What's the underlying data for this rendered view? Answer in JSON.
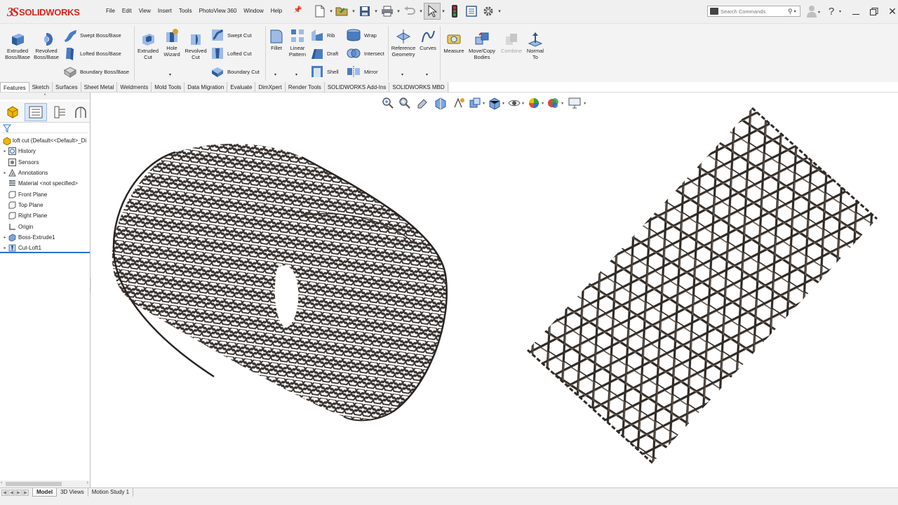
{
  "app": {
    "logo_mark": "3S",
    "logo_text": "SOLIDWORKS"
  },
  "menu": [
    "File",
    "Edit",
    "View",
    "Insert",
    "Tools",
    "PhotoView 360",
    "Window",
    "Help"
  ],
  "search": {
    "placeholder": "Search Commands"
  },
  "toolbar": {
    "extruded_boss": "Extruded Boss/Base",
    "revolved_boss": "Revolved Boss/Base",
    "swept_boss": "Swept Boss/Base",
    "lofted_boss": "Lofted Boss/Base",
    "boundary_boss": "Boundary Boss/Base",
    "extruded_cut": "Extruded Cut",
    "hole_wizard": "Hole Wizard",
    "revolved_cut": "Revolved Cut",
    "swept_cut": "Swept Cut",
    "lofted_cut": "Lofted Cut",
    "boundary_cut": "Boundary Cut",
    "fillet": "Fillet",
    "linear_pattern": "Linear Pattern",
    "rib": "Rib",
    "draft": "Draft",
    "shell": "Shell",
    "wrap": "Wrap",
    "intersect": "Intersect",
    "mirror": "Mirror",
    "reference_geometry": "Reference Geometry",
    "curves": "Curves",
    "measure": "Measure",
    "move_copy": "Move/Copy Bodies",
    "combine": "Combine",
    "normal_to": "Normal To"
  },
  "tabs": [
    "Features",
    "Sketch",
    "Surfaces",
    "Sheet Metal",
    "Weldments",
    "Mold Tools",
    "Data Migration",
    "Evaluate",
    "DimXpert",
    "Render Tools",
    "SOLIDWORKS Add-Ins",
    "SOLIDWORKS MBD"
  ],
  "active_tab": "Features",
  "tree": {
    "root": "loft cut  (Default<<Default>_Di",
    "items": [
      {
        "label": "History",
        "icon": "history-icon",
        "expandable": true
      },
      {
        "label": "Sensors",
        "icon": "sensors-icon",
        "expandable": false
      },
      {
        "label": "Annotations",
        "icon": "annotations-icon",
        "expandable": true
      },
      {
        "label": "Material <not specified>",
        "icon": "material-icon",
        "expandable": false
      },
      {
        "label": "Front Plane",
        "icon": "plane-icon",
        "expandable": false
      },
      {
        "label": "Top Plane",
        "icon": "plane-icon",
        "expandable": false
      },
      {
        "label": "Right Plane",
        "icon": "plane-icon",
        "expandable": false
      },
      {
        "label": "Origin",
        "icon": "origin-icon",
        "expandable": false
      },
      {
        "label": "Boss-Extrude1",
        "icon": "extrude-feature-icon",
        "expandable": true
      },
      {
        "label": "Cut-Loft1",
        "icon": "cut-loft-feature-icon",
        "expandable": true
      }
    ]
  },
  "bottom_tabs": [
    "Model",
    "3D Views",
    "Motion Study 1"
  ],
  "active_bottom_tab": "Model",
  "colors": {
    "accent": "#2a6fd1",
    "brand": "#d9251c",
    "mesh_dark": "#2f2a26",
    "mesh_light": "#8a7b6e"
  }
}
